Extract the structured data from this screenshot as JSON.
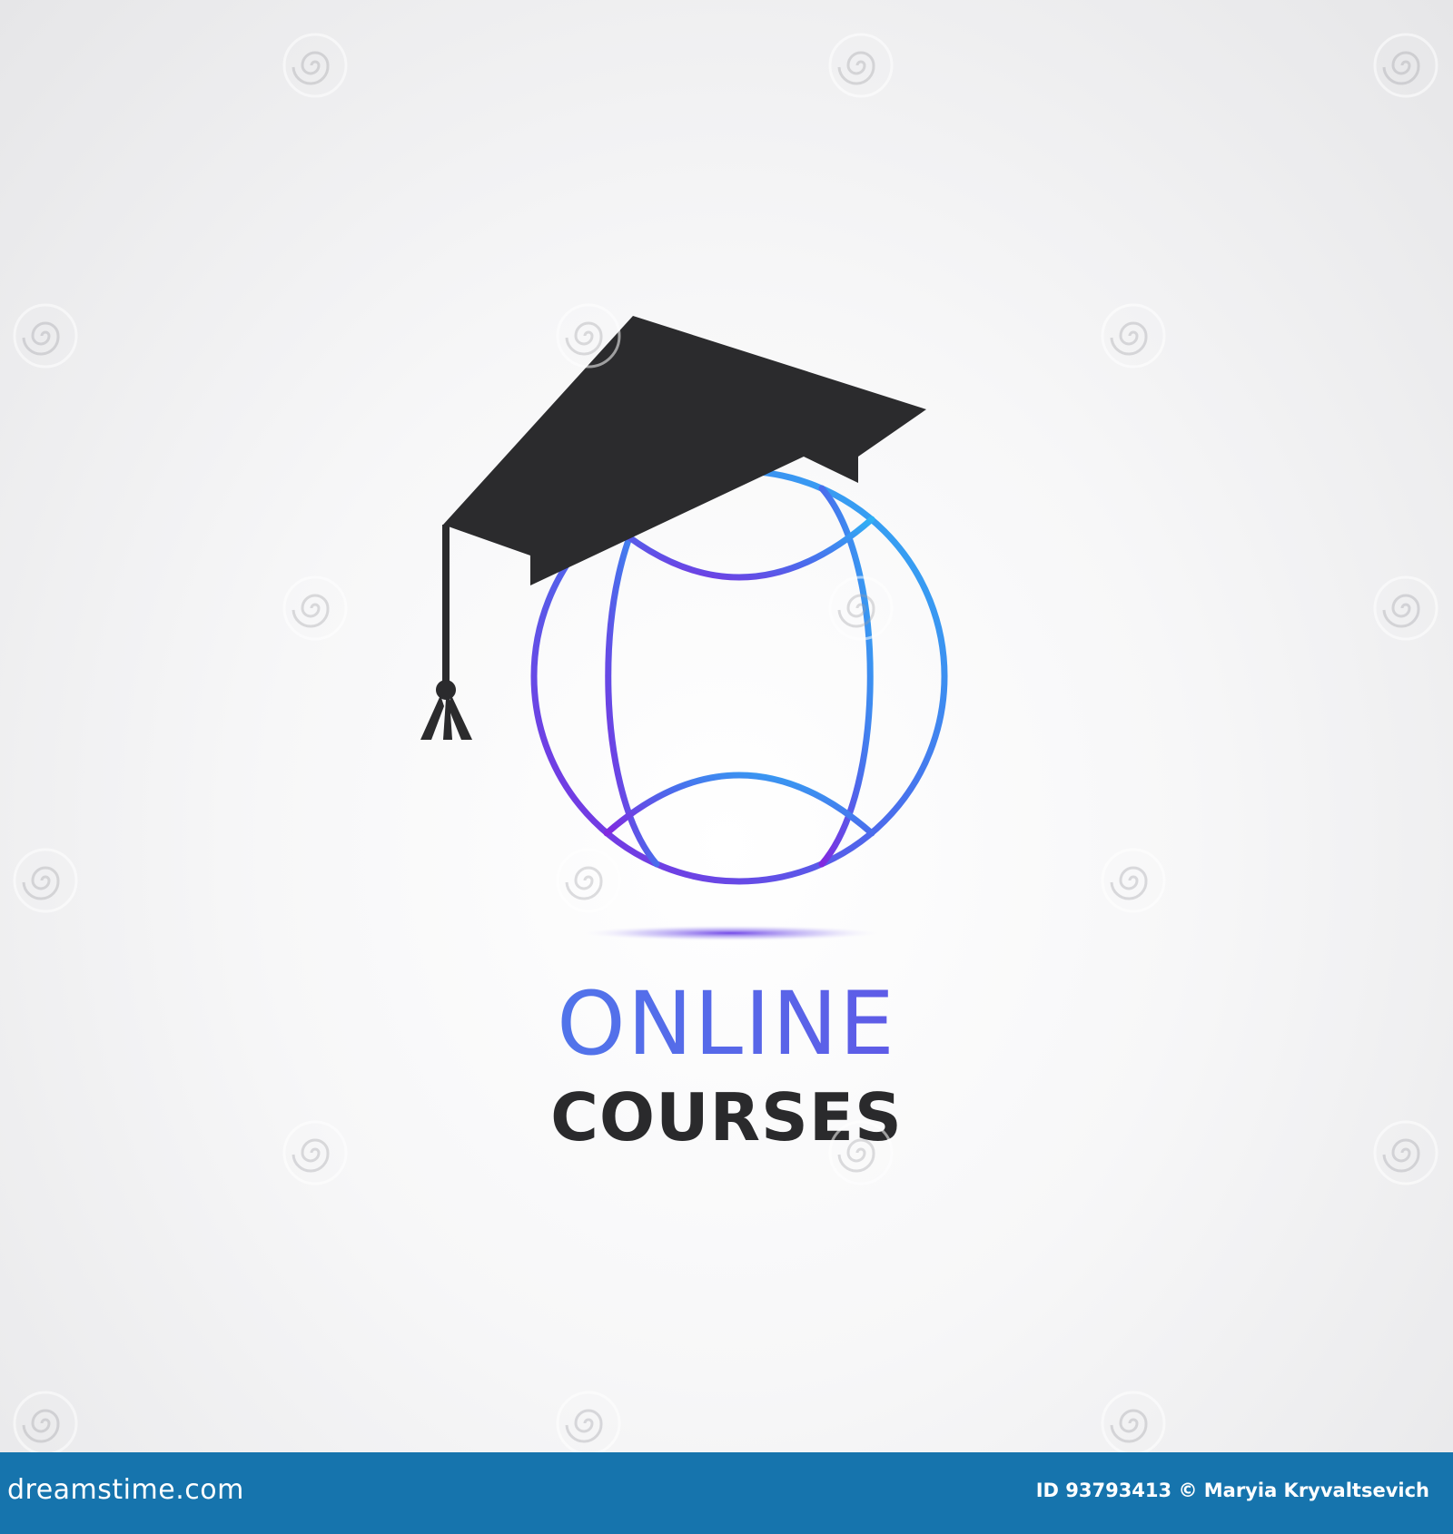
{
  "logo": {
    "line1": "ONLINE",
    "line2": "COURSES",
    "icon": "globe-with-graduation-cap-icon",
    "colors": {
      "gradient_start": "#3aa0f2",
      "gradient_end": "#7a2de0",
      "cap": "#2b2b2d",
      "courses_text": "#2a2a2c"
    }
  },
  "watermark": {
    "brand": "dreamstime",
    "icon": "dreamstime-spiral-icon"
  },
  "footer": {
    "brand": "dreamstime.com",
    "credit": "ID 93793413 © Maryia Kryvaltsevich",
    "background": "#1674ad"
  }
}
